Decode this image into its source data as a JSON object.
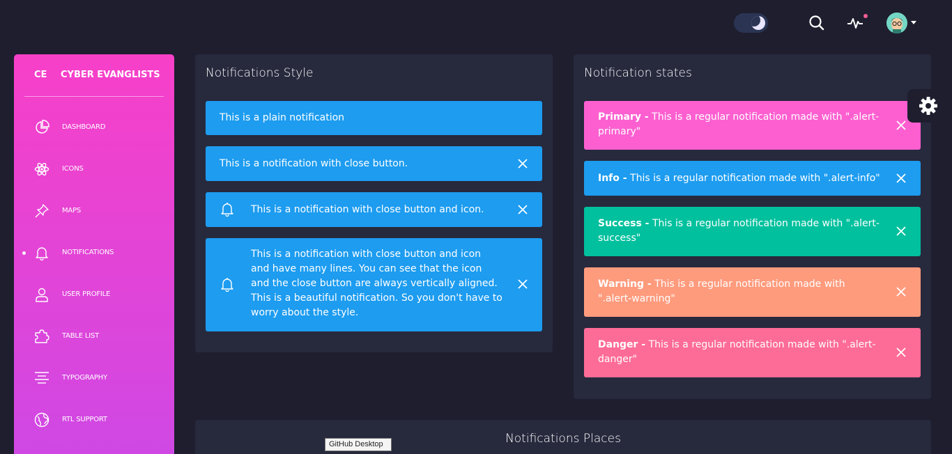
{
  "navbar": {
    "toggle_icon": "moon-icon",
    "search_icon": "search-icon",
    "activity_icon": "pulse-icon",
    "avatar_icon": "avatar-icon"
  },
  "sidebar": {
    "logo_mini": "CE",
    "logo_full": "CYBER EVANGLISTS",
    "items": [
      {
        "label": "DASHBOARD",
        "icon": "chart-pie-icon"
      },
      {
        "label": "ICONS",
        "icon": "atom-icon"
      },
      {
        "label": "MAPS",
        "icon": "pin-icon"
      },
      {
        "label": "NOTIFICATIONS",
        "icon": "bell-icon",
        "active": true
      },
      {
        "label": "USER PROFILE",
        "icon": "user-icon"
      },
      {
        "label": "TABLE LIST",
        "icon": "puzzle-icon"
      },
      {
        "label": "TYPOGRAPHY",
        "icon": "align-center-icon"
      },
      {
        "label": "RTL SUPPORT",
        "icon": "world-icon"
      }
    ]
  },
  "styles_card": {
    "title": "Notifications Style",
    "alerts": [
      {
        "text": "This is a plain notification"
      },
      {
        "text": "This is a notification with close button."
      },
      {
        "text": "This is a notification with close button and icon."
      },
      {
        "text_lines": [
          "This is a notification with close button and icon",
          "and have many lines. You can see that the icon",
          "and the close button are always vertically aligned.",
          "This is a beautiful notification. So you don't have to",
          "worry about the style."
        ]
      }
    ]
  },
  "states_card": {
    "title": "Notification states",
    "alerts": [
      {
        "type": "Primary",
        "bold": "Primary -",
        "lines": [
          " This is a regular notification made with \".alert-",
          "primary\""
        ],
        "color": "#fd5fd0"
      },
      {
        "type": "Info",
        "bold": "Info -",
        "lines": [
          " This is a regular notification made with \".alert-info\""
        ],
        "color": "#1d9cf0"
      },
      {
        "type": "Success",
        "bold": "Success -",
        "lines": [
          " This is a regular notification made with \".alert-",
          "success\""
        ],
        "color": "#00c09d"
      },
      {
        "type": "Warning",
        "bold": "Warning -",
        "lines": [
          " This is a regular notification made with",
          "\".alert-warning\""
        ],
        "color": "#ff9b7d"
      },
      {
        "type": "Danger",
        "bold": "Danger -",
        "lines": [
          " This is a regular notification made with \".alert-",
          "danger\""
        ],
        "color": "#fd6b97"
      }
    ]
  },
  "places_card": {
    "title": "Notifications Places"
  },
  "settings": {
    "icon": "gear-icon"
  },
  "tooltip": {
    "text": "GitHub Desktop"
  },
  "colors": {
    "background": "#1e1e2f",
    "card": "#27293d",
    "info": "#1d9cf0",
    "sidebar_start": "#f740c8",
    "sidebar_end": "#cf48e4"
  }
}
